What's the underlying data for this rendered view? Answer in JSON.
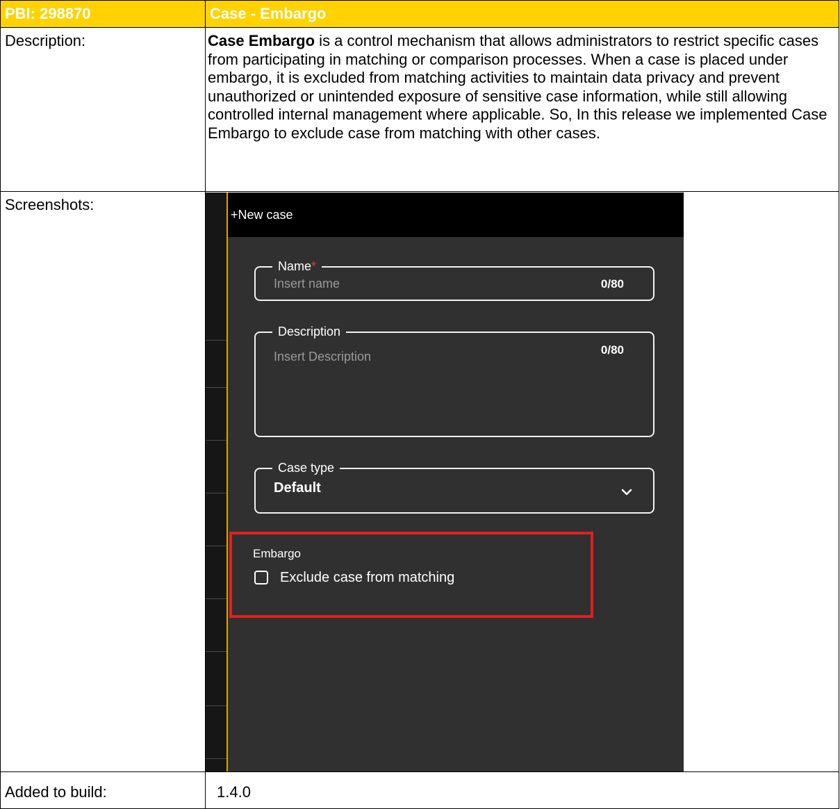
{
  "header": {
    "pbi": "PBI: 298870",
    "title": "Case - Embargo"
  },
  "description": {
    "label": "Description:",
    "bold_lead": "Case Embargo",
    "text": " is a control mechanism that allows administrators to restrict specific cases from participating in matching or comparison processes. When a case is placed under embargo, it is excluded from matching activities to maintain data privacy and prevent unauthorized or unintended exposure of sensitive case information, while still allowing controlled internal management where applicable. So, In this release we implemented Case Embargo to exclude case from matching with other cases."
  },
  "screenshots": {
    "label": "Screenshots:",
    "panel": {
      "new_case": "+New case",
      "name_field": {
        "label": "Name",
        "required_mark": "*",
        "placeholder": "Insert name",
        "counter": "0/80"
      },
      "description_field": {
        "label": "Description",
        "placeholder": "Insert Description",
        "counter": "0/80"
      },
      "case_type_field": {
        "label": "Case type",
        "value": "Default",
        "icon": "chevron-down-icon"
      },
      "embargo": {
        "title": "Embargo",
        "checkbox_label": "Exclude case from matching",
        "checked": false
      },
      "colors": {
        "background": "#303030",
        "accent": "#e0a400",
        "highlight_box": "#e02020"
      }
    }
  },
  "build": {
    "label": "Added to build:",
    "value": "1.4.0"
  },
  "colors": {
    "header_bg": "#ffd200",
    "header_text": "#ffffff"
  }
}
